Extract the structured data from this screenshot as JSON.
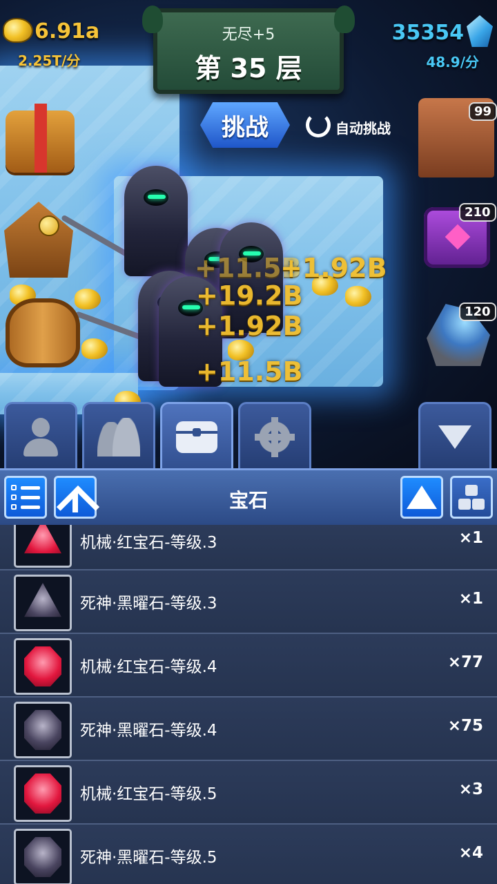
{
  "resources": {
    "gold": "6.91a",
    "gold_rate": "2.25T/分",
    "gems": "35354",
    "gem_rate": "48.9/分"
  },
  "floor": {
    "mode": "无尽+5",
    "title": "第 35 层"
  },
  "actions": {
    "challenge_label": "挑战",
    "auto_challenge_label": "自动挑战"
  },
  "side_items": {
    "robot_count": "99",
    "chest_count": "210",
    "ore_count": "120"
  },
  "damage_numbers": [
    "+11.5B",
    "+1.92B",
    "+19.2B",
    "+1.92B",
    "+11.5B"
  ],
  "bottom_tabs": [
    "hero",
    "team",
    "bag",
    "settings",
    "collapse"
  ],
  "panel": {
    "title": "宝石"
  },
  "gems": [
    {
      "name": "机械·红宝石-等级.3",
      "count": "×1",
      "color": "red",
      "shape": "tri"
    },
    {
      "name": "死神·黑曜石-等级.3",
      "count": "×1",
      "color": "black",
      "shape": "tri"
    },
    {
      "name": "机械·红宝石-等级.4",
      "count": "×77",
      "color": "red",
      "shape": "oct"
    },
    {
      "name": "死神·黑曜石-等级.4",
      "count": "×75",
      "color": "black",
      "shape": "oct"
    },
    {
      "name": "机械·红宝石-等级.5",
      "count": "×3",
      "color": "red",
      "shape": "oct"
    },
    {
      "name": "死神·黑曜石-等级.5",
      "count": "×4",
      "color": "black",
      "shape": "oct"
    }
  ],
  "colors": {
    "gold": "#f6c338",
    "gem": "#49c8f5",
    "panel": "#2c3b5a"
  }
}
